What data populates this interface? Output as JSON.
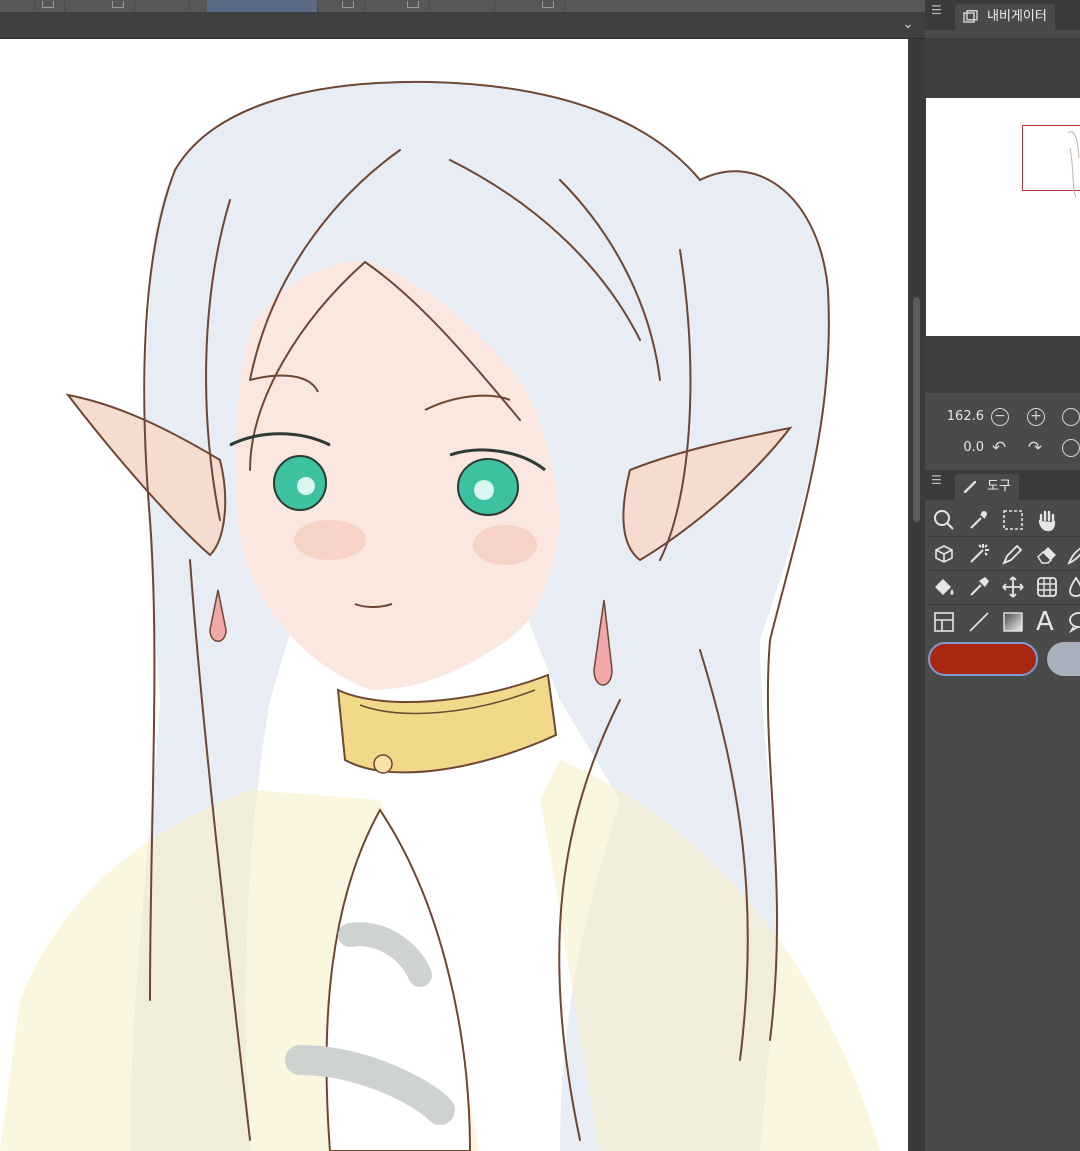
{
  "toolbar": {
    "buttons": [
      "tool-1",
      "tool-2",
      "tool-3",
      "tool-4",
      "tool-5",
      "tool-6",
      "tool-7",
      "tool-8",
      "tool-9",
      "tool-10"
    ],
    "active_index": 5,
    "collapse_icon": "chevron-down-icon",
    "collapse_glyph": "⌄"
  },
  "canvas": {
    "description_icon": "elf-girl-illustration",
    "colors": {
      "line": "#6e4634",
      "hair": "#e7ecf5",
      "skin": "#f7dcd2",
      "eye": "#3cc2a0",
      "collar": "#f2d98a",
      "cape": "#f7efc4",
      "dark": "#cfd3d0"
    }
  },
  "navigator": {
    "panel_menu": "☰",
    "tab_label": "내비게이터",
    "tab_icon": "layers-icon",
    "zoom_value": "162.6",
    "rotation_value": "0.0",
    "zoom_out_glyph": "−",
    "zoom_in_glyph": "+",
    "rotate_left_glyph": "↶",
    "rotate_right_glyph": "↷"
  },
  "tools": {
    "panel_menu": "☰",
    "tab_label": "도구",
    "tab_icon": "brush-icon",
    "rows": [
      [
        "zoom-tool",
        "eyedropper-tool",
        "selection-tool",
        "hand-tool"
      ],
      [
        "object-tool",
        "auto-select-tool",
        "pen-tool",
        "eraser-tool",
        "brush-tool"
      ],
      [
        "fill-tool",
        "blend-tool",
        "move-tool",
        "grid-tool",
        "water-tool"
      ],
      [
        "frame-tool",
        "line-tool",
        "gradient-tool",
        "text-tool",
        "balloon-tool"
      ]
    ],
    "text_glyph": "A"
  },
  "colors": {
    "main": "#a82710",
    "sub": "#a9b0bd"
  }
}
